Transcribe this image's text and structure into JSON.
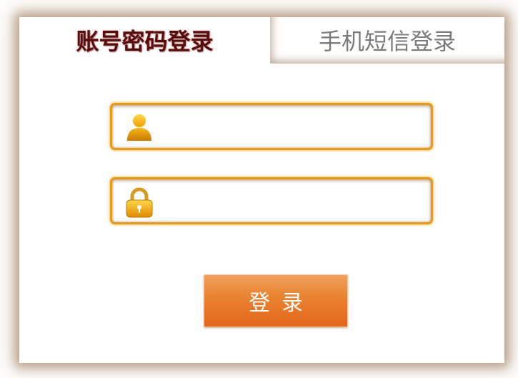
{
  "tabs": {
    "account_password": "账号密码登录",
    "sms": "手机短信登录"
  },
  "form": {
    "username": {
      "value": "",
      "placeholder": "",
      "icon": "user-icon"
    },
    "password": {
      "value": "",
      "placeholder": "",
      "icon": "lock-icon"
    },
    "submit_label": "登录"
  },
  "colors": {
    "active_tab_text": "#5a0c0c",
    "inactive_tab_text": "#7b7b7b",
    "field_border": "#e59a1c",
    "button": "#e3661a",
    "icon_gold": "#f0b000"
  }
}
